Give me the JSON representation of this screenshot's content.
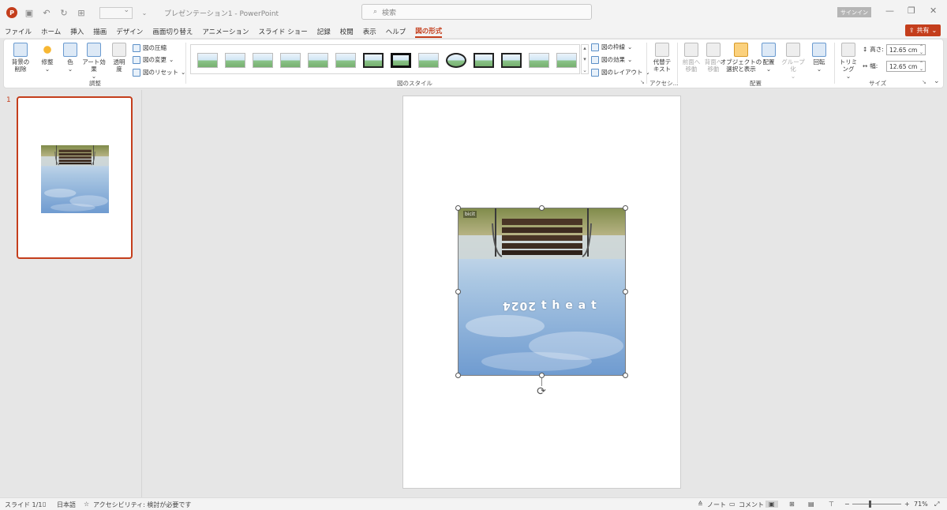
{
  "titlebar": {
    "doc_title": "プレゼンテーション1 - PowerPoint",
    "search_placeholder": "検索",
    "signin": "サインイン",
    "app_logo": "P"
  },
  "menu": {
    "tabs": [
      "ファイル",
      "ホーム",
      "挿入",
      "描画",
      "デザイン",
      "画面切り替え",
      "アニメーション",
      "スライド ショー",
      "記録",
      "校閲",
      "表示",
      "ヘルプ",
      "図の形式"
    ],
    "active_tab": "図の形式",
    "share": "共有"
  },
  "ribbon": {
    "adjust": {
      "remove_bg": "背景の\n削除",
      "corrections": "修整",
      "color": "色",
      "artistic": "アート効果",
      "transparency": "透明\n度",
      "compress": "図の圧縮",
      "change": "図の変更",
      "reset": "図のリセット",
      "label": "調整"
    },
    "styles": {
      "border": "図の枠線",
      "effects": "図の効果",
      "layout": "図のレイアウト",
      "label": "図のスタイル"
    },
    "accessibility": {
      "alt_text": "代替テ\nキスト",
      "label": "アクセシ..."
    },
    "arrange": {
      "bring_forward": "前面へ\n移動",
      "send_backward": "背面へ\n移動",
      "selection_pane": "オブジェクトの\n選択と表示",
      "align": "配置",
      "group": "グループ化",
      "rotate": "回転",
      "label": "配置"
    },
    "size": {
      "crop": "トリミング",
      "height_label": "高さ:",
      "height_value": "12.65 cm",
      "width_label": "幅:",
      "width_value": "12.65 cm",
      "label": "サイズ"
    }
  },
  "slides_panel": {
    "slide_number": "1"
  },
  "picture": {
    "mirrored_text": "ʇ ɐ ǝ ɥ ʇ 2024",
    "watermark": "bicit"
  },
  "statusbar": {
    "slide_info": "スライド 1/1",
    "language": "日本語",
    "accessibility": "アクセシビリティ: 検討が必要です",
    "notes": "ノート",
    "comments": "コメント",
    "zoom": "71%"
  }
}
